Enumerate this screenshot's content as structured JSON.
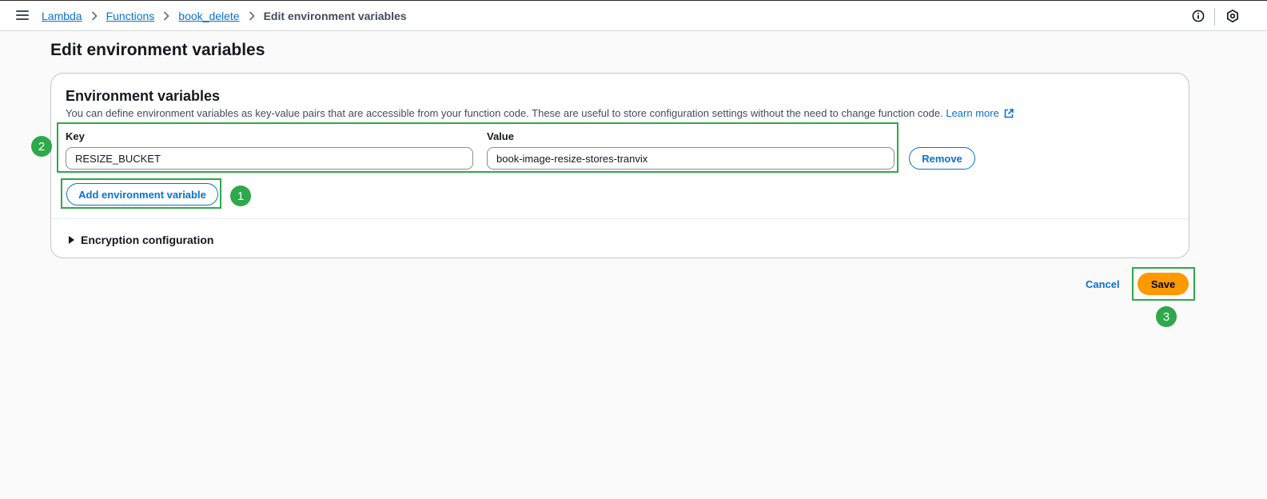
{
  "breadcrumb": {
    "items": [
      "Lambda",
      "Functions",
      "book_delete"
    ],
    "current": "Edit environment variables"
  },
  "icons": {
    "menu": "hamburger-menu-icon",
    "separator": "chevron-right-icon",
    "info": "info-icon",
    "settings": "settings-icon",
    "external": "external-link-icon",
    "caret": "caret-right-icon"
  },
  "page": {
    "title": "Edit environment variables"
  },
  "env_panel": {
    "title": "Environment variables",
    "description": "You can define environment variables as key-value pairs that are accessible from your function code. These are useful to store configuration settings without the need to change function code.",
    "learn_more": "Learn more",
    "key_label": "Key",
    "value_label": "Value",
    "variables": [
      {
        "key": "RESIZE_BUCKET",
        "value": "book-image-resize-stores-tranvix"
      }
    ],
    "remove_label": "Remove",
    "add_label": "Add environment variable",
    "encryption_label": "Encryption configuration"
  },
  "actions": {
    "cancel_label": "Cancel",
    "save_label": "Save"
  },
  "annotations": {
    "badges": [
      "1",
      "2",
      "3"
    ],
    "color": "#2ea84a"
  },
  "colors": {
    "link": "#0972d3",
    "primary_button": "#ff9900"
  }
}
